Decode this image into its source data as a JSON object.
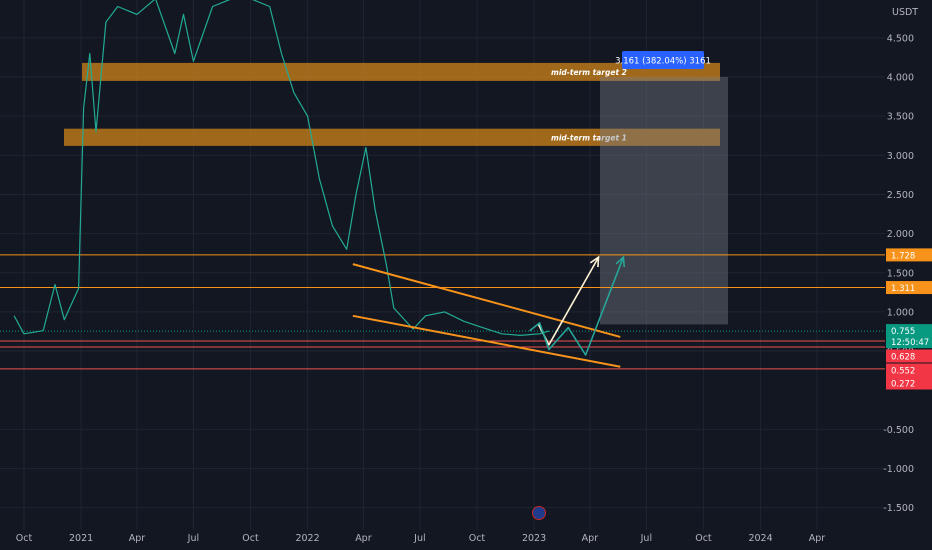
{
  "chart_data": {
    "type": "candlestick",
    "currency": "USDT",
    "y_ticks": [
      "4.500",
      "4.000",
      "3.500",
      "3.000",
      "2.500",
      "2.000",
      "1.500",
      "1.000",
      "0.500",
      "-0.500",
      "-1.000",
      "-1.500"
    ],
    "x_ticks": [
      "Oct",
      "2021",
      "Apr",
      "Jul",
      "Oct",
      "2022",
      "Apr",
      "Jul",
      "Oct",
      "2023",
      "Apr",
      "Jul",
      "Oct",
      "2024",
      "Apr"
    ],
    "ylim": [
      -1.65,
      5.0
    ],
    "price_series": [
      [
        "2020-09-15",
        0.95
      ],
      [
        "2020-10-01",
        0.72
      ],
      [
        "2020-11-01",
        0.76
      ],
      [
        "2020-11-20",
        1.35
      ],
      [
        "2020-12-05",
        0.9
      ],
      [
        "2020-12-28",
        1.3
      ],
      [
        "2021-01-05",
        3.6
      ],
      [
        "2021-01-15",
        4.3
      ],
      [
        "2021-01-25",
        3.3
      ],
      [
        "2021-02-10",
        4.7
      ],
      [
        "2021-03-01",
        4.9
      ],
      [
        "2021-04-01",
        4.8
      ],
      [
        "2021-05-01",
        5.0
      ],
      [
        "2021-06-01",
        4.3
      ],
      [
        "2021-06-15",
        4.8
      ],
      [
        "2021-07-01",
        4.2
      ],
      [
        "2021-08-01",
        4.9
      ],
      [
        "2021-09-01",
        5.0
      ],
      [
        "2021-10-01",
        5.0
      ],
      [
        "2021-11-01",
        4.9
      ],
      [
        "2021-11-20",
        4.3
      ],
      [
        "2021-12-10",
        3.8
      ],
      [
        "2022-01-01",
        3.5
      ],
      [
        "2022-01-20",
        2.7
      ],
      [
        "2022-02-10",
        2.1
      ],
      [
        "2022-03-05",
        1.8
      ],
      [
        "2022-03-20",
        2.5
      ],
      [
        "2022-04-05",
        3.1
      ],
      [
        "2022-04-20",
        2.3
      ],
      [
        "2022-05-08",
        1.6
      ],
      [
        "2022-05-20",
        1.05
      ],
      [
        "2022-06-20",
        0.78
      ],
      [
        "2022-07-10",
        0.95
      ],
      [
        "2022-08-10",
        1.0
      ],
      [
        "2022-09-10",
        0.88
      ],
      [
        "2022-10-10",
        0.8
      ],
      [
        "2022-11-10",
        0.72
      ],
      [
        "2022-12-10",
        0.7
      ],
      [
        "2023-01-10",
        0.72
      ],
      [
        "2023-01-25",
        0.755
      ]
    ],
    "horizontal_levels": [
      {
        "label": "1.728",
        "price": 1.728,
        "color": "#f7931a",
        "label_bg": "#f7931a"
      },
      {
        "label": "1.311",
        "price": 1.311,
        "color": "#f7931a",
        "label_bg": "#f7931a"
      },
      {
        "label": "0.628",
        "price": 0.628,
        "color": "#ef5350",
        "label_bg": "#f23645"
      },
      {
        "label": "0.552",
        "price": 0.552,
        "color": "#ef5350",
        "label_bg": "#f23645"
      },
      {
        "label": "0.272",
        "price": 0.272,
        "color": "#ef5350",
        "label_bg": "#f23645"
      }
    ],
    "current_price": {
      "label": "0.755",
      "countdown": "12:50:47",
      "price": 0.755,
      "color": "#089981"
    },
    "zones": [
      {
        "label": "mid-term target 2",
        "price_low": 3.95,
        "price_high": 4.18,
        "color": "#c87f19"
      },
      {
        "label": "mid-term target 1",
        "price_low": 3.12,
        "price_high": 3.34,
        "color": "#c87f19"
      }
    ],
    "projection_box": {
      "label": "3.161 (382.04%) 3161",
      "price_low": 0.84,
      "price_high": 4.0,
      "color": "#2962ff"
    },
    "channel": {
      "upper": [
        [
          "2022-03-15",
          1.61
        ],
        [
          "2023-05-20",
          0.68
        ]
      ],
      "lower": [
        [
          "2022-03-15",
          0.95
        ],
        [
          "2023-05-20",
          0.3
        ]
      ],
      "color": "#f7931a"
    },
    "paths": [
      {
        "color": "#fff3d6",
        "points": [
          [
            "2023-01-08",
            0.84
          ],
          [
            "2023-01-25",
            0.58
          ],
          [
            "2023-04-15",
            1.7
          ]
        ]
      },
      {
        "color": "#26a69a",
        "points": [
          [
            "2022-12-25",
            0.76
          ],
          [
            "2023-01-10",
            0.86
          ],
          [
            "2023-01-25",
            0.52
          ],
          [
            "2023-02-25",
            0.8
          ],
          [
            "2023-03-25",
            0.45
          ],
          [
            "2023-05-25",
            1.7
          ]
        ]
      }
    ]
  }
}
